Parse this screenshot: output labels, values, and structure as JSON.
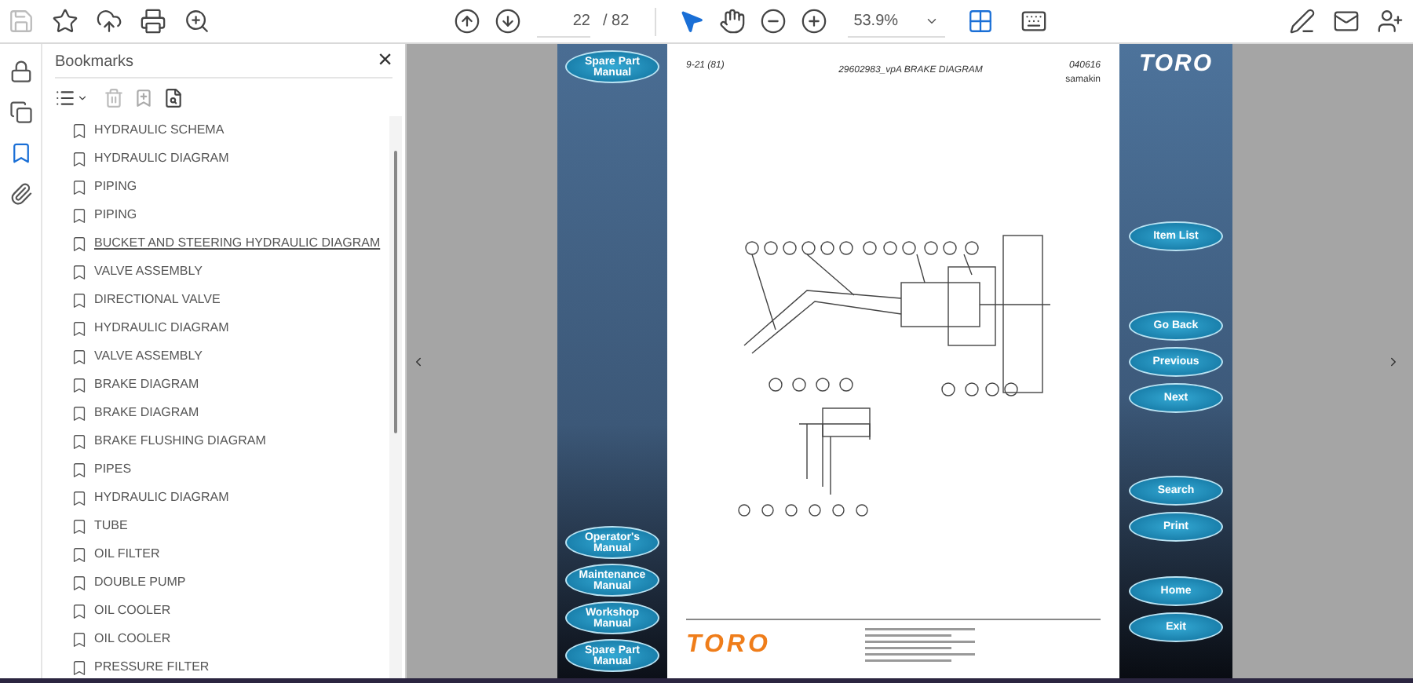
{
  "toolbar": {
    "page_current": "22",
    "page_total": "/ 82",
    "zoom": "53.9%",
    "tools": [
      {
        "kind": "select",
        "selected": true
      },
      {
        "kind": "hand",
        "selected": false
      }
    ]
  },
  "side_rail": [
    {
      "kind": "lock",
      "selected": false
    },
    {
      "kind": "pages",
      "selected": false
    },
    {
      "kind": "bookmark",
      "selected": true
    },
    {
      "kind": "attachment",
      "selected": false
    }
  ],
  "bookmarks": {
    "title": "Bookmarks",
    "close": "×",
    "items": [
      {
        "label": "HYDRAULIC SCHEMA",
        "selected": false
      },
      {
        "label": "HYDRAULIC DIAGRAM",
        "selected": false
      },
      {
        "label": "PIPING",
        "selected": false
      },
      {
        "label": "PIPING",
        "selected": false
      },
      {
        "label": "BUCKET AND STEERING HYDRAULIC DIAGRAM",
        "selected": true
      },
      {
        "label": "VALVE ASSEMBLY",
        "selected": false
      },
      {
        "label": "DIRECTIONAL VALVE",
        "selected": false
      },
      {
        "label": "HYDRAULIC DIAGRAM",
        "selected": false
      },
      {
        "label": "VALVE ASSEMBLY",
        "selected": false
      },
      {
        "label": "BRAKE DIAGRAM",
        "selected": false
      },
      {
        "label": "BRAKE DIAGRAM",
        "selected": false
      },
      {
        "label": "BRAKE FLUSHING DIAGRAM",
        "selected": false
      },
      {
        "label": "PIPES",
        "selected": false
      },
      {
        "label": "HYDRAULIC DIAGRAM",
        "selected": false
      },
      {
        "label": "TUBE",
        "selected": false
      },
      {
        "label": "OIL FILTER",
        "selected": false
      },
      {
        "label": "DOUBLE PUMP",
        "selected": false
      },
      {
        "label": "OIL COOLER",
        "selected": false
      },
      {
        "label": "OIL COOLER",
        "selected": false
      },
      {
        "label": "PRESSURE FILTER",
        "selected": false
      }
    ]
  },
  "page": {
    "left_top_button": "Spare Part Manual",
    "left_bottom_buttons": [
      "Operator's Manual",
      "Maintenance Manual",
      "Workshop Manual",
      "Spare Part Manual"
    ],
    "header": {
      "sheet": "9-21 (81)",
      "title": "29602983_vpA BRAKE DIAGRAM",
      "date": "040616",
      "author": "samakin"
    },
    "logo": "TORO",
    "footer_logo": "TORO",
    "right_button_groups": [
      [
        "Item List"
      ],
      [
        "Go Back",
        "Previous",
        "Next"
      ],
      [
        "Search",
        "Print"
      ],
      [
        "Home",
        "Exit"
      ]
    ]
  }
}
